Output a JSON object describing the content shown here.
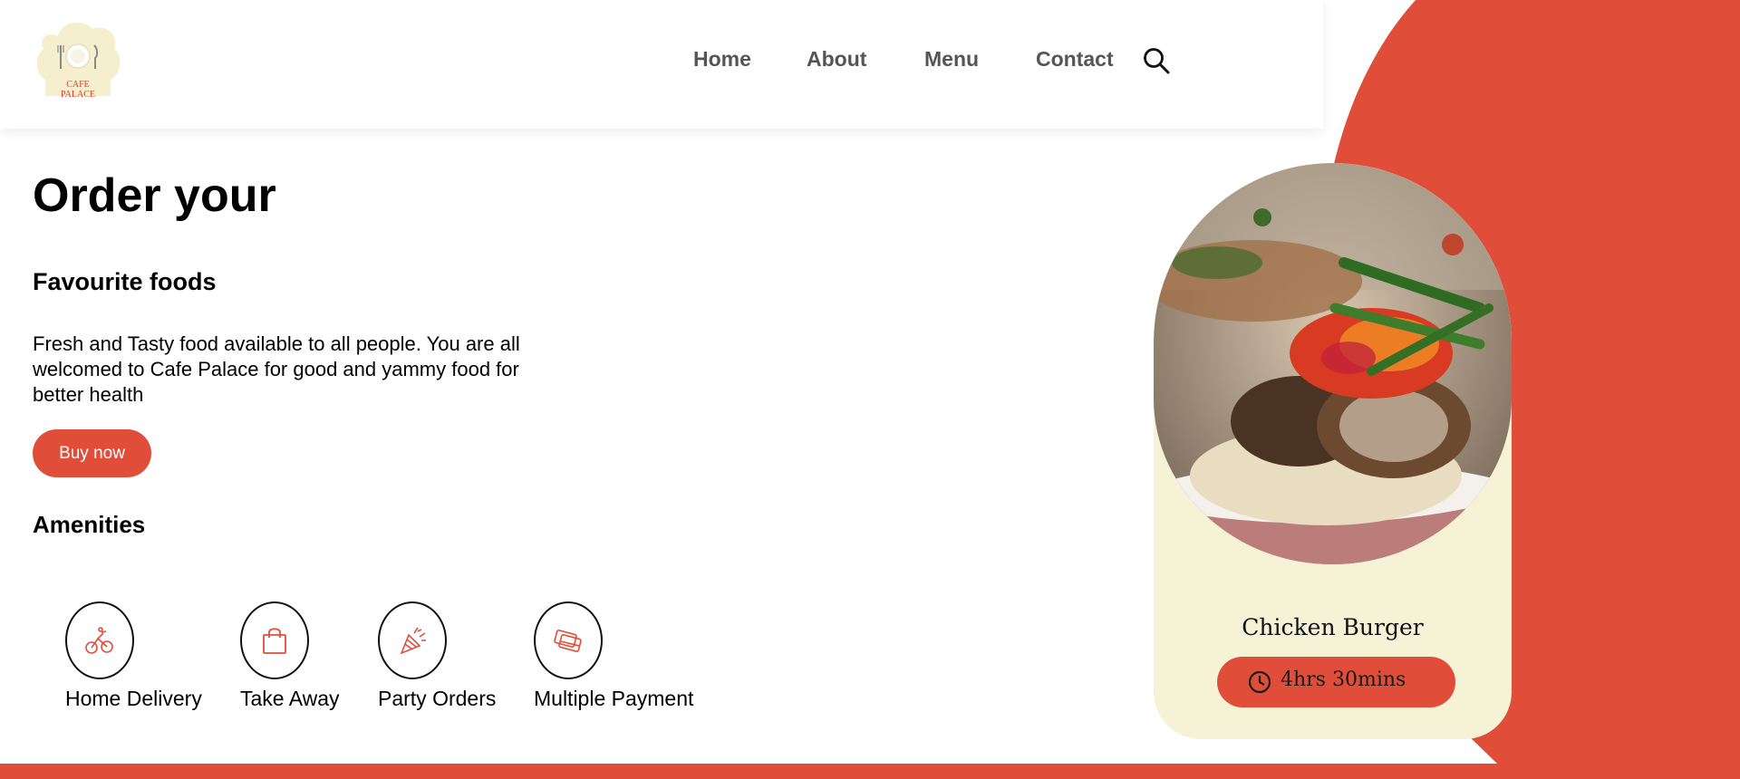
{
  "colors": {
    "accent": "#e04e39",
    "card_bg": "#f6f2d6",
    "nav_text": "#555555"
  },
  "logo": {
    "text_line1": "CAFE",
    "text_line2": "PALACE"
  },
  "nav": {
    "items": [
      {
        "label": "Home"
      },
      {
        "label": "About"
      },
      {
        "label": "Menu"
      },
      {
        "label": "Contact"
      }
    ],
    "search_icon": "search-icon"
  },
  "hero": {
    "title": "Order your",
    "subtitle": "Favourite foods",
    "description": "Fresh and Tasty food available to all people. You are all welcomed to Cafe Palace for good and yammy food for better health",
    "cta_label": "Buy now"
  },
  "amenities": {
    "title": "Amenities",
    "items": [
      {
        "label": "Home Delivery",
        "icon": "bicycle-icon"
      },
      {
        "label": "Take Away",
        "icon": "shopping-bag-icon"
      },
      {
        "label": "Party Orders",
        "icon": "party-popper-icon"
      },
      {
        "label": "Multiple Payment",
        "icon": "credit-cards-icon"
      }
    ]
  },
  "food_card": {
    "dish_name": "Chicken Burger",
    "time": "4hrs 30mins",
    "time_icon": "clock-icon"
  }
}
